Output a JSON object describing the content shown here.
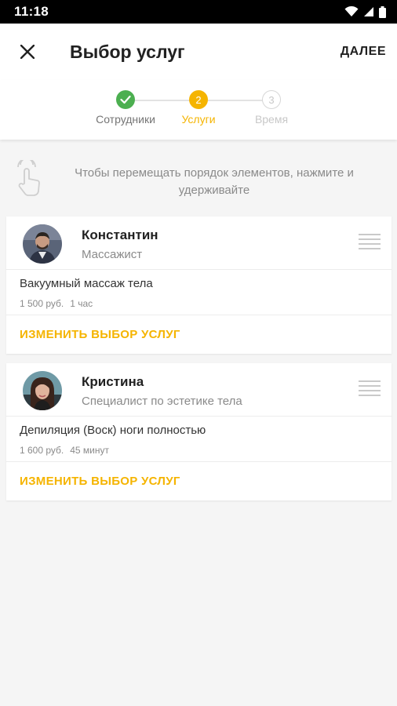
{
  "status_bar": {
    "time": "11:18"
  },
  "app_bar": {
    "title": "Выбор услуг",
    "next_label": "ДАЛЕЕ"
  },
  "stepper": {
    "steps": [
      {
        "label": "Сотрудники",
        "number": "1",
        "state": "done"
      },
      {
        "label": "Услуги",
        "number": "2",
        "state": "active"
      },
      {
        "label": "Время",
        "number": "3",
        "state": "pending"
      }
    ]
  },
  "hint": {
    "text": "Чтобы перемещать порядок элементов, нажмите и удерживайте",
    "icon": "touch-hold-icon"
  },
  "cards": [
    {
      "name": "Константин",
      "role": "Массажист",
      "service": {
        "name": "Вакуумный массаж тела",
        "price": "1 500 руб.",
        "duration": "1 час"
      },
      "change_label": "ИЗМЕНИТЬ ВЫБОР УСЛУГ"
    },
    {
      "name": "Кристина",
      "role": "Специалист по эстетике тела",
      "service": {
        "name": "Депиляция (Воск) ноги полностью",
        "price": "1 600 руб.",
        "duration": "45 минут"
      },
      "change_label": "ИЗМЕНИТЬ ВЫБОР УСЛУГ"
    }
  ],
  "colors": {
    "accent": "#f5b400",
    "done": "#4caf50",
    "text_secondary": "#8a8a8a"
  }
}
